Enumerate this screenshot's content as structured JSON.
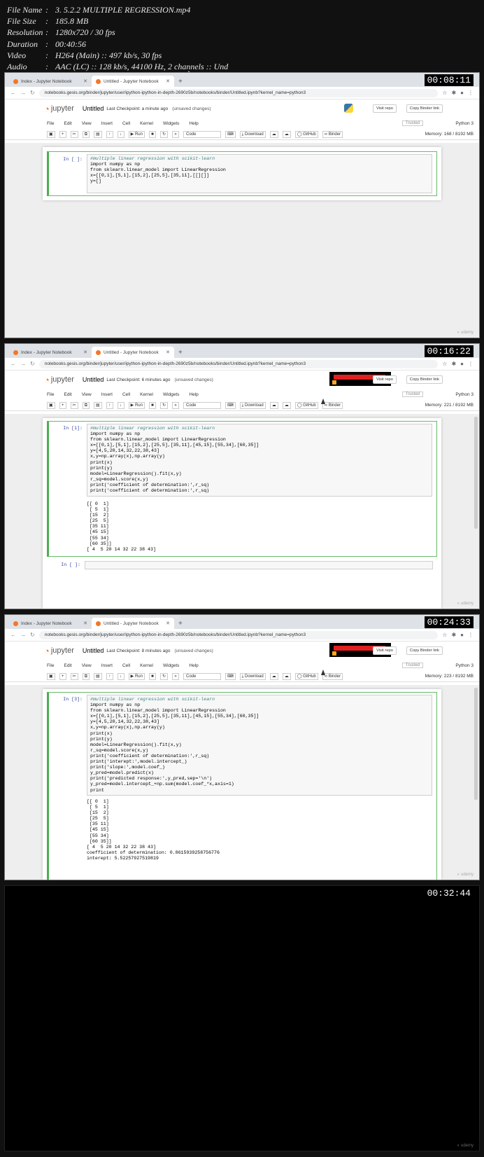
{
  "meta": [
    {
      "key": "File Name",
      "value": "3. 5.2.2 MULTIPLE REGRESSION.mp4"
    },
    {
      "key": "File Size",
      "value": "185.8 MB"
    },
    {
      "key": "Resolution",
      "value": "1280x720 / 30 fps"
    },
    {
      "key": "Duration",
      "value": "00:40:56"
    },
    {
      "key": "Video",
      "value": "H264 (Main) :: 497 kb/s, 30 fps"
    },
    {
      "key": "Audio",
      "value": "AAC (LC) :: 128 kb/s, 44100 Hz, 2 channels :: Und"
    }
  ],
  "browser": {
    "tab1": "Index - Jupyter Notebook",
    "tab2_f1": "Untitled - Jupyter Notebook",
    "tab2": "Untitled - Jupyter Notebook",
    "url": "notebooks.gesis.org/binder/jupyter/user/ipython-ipython-in-depth-2690z5b/notebooks/binder/Untitled.ipynb?kernel_name=python3"
  },
  "jupyter": {
    "logo_word": "jupyter",
    "title": "Untitled",
    "unsaved": "(unsaved changes)",
    "visit_repo": "Visit repo",
    "copy_binder": "Copy Binder link",
    "menus": [
      "File",
      "Edit",
      "View",
      "Insert",
      "Cell",
      "Kernel",
      "Widgets",
      "Help"
    ],
    "trusted": "Trusted",
    "kernel": "Python 3",
    "run": "Run",
    "celltype": "Code",
    "download": "Download",
    "github": "GitHub",
    "binder": "Binder"
  },
  "frames": [
    {
      "timestamp": "00:08:11",
      "checkpoint": "Last Checkpoint: a minute ago",
      "memory": "Memory: 168 / 8192 MB",
      "prompt": "In [ ]:",
      "code": [
        "#multiple linear regression with scikit-learn",
        "import numpy as np",
        "from sklearn.linear_model import LinearRegression",
        "x=[[0,1],[5,1],[15,2],[25,5],[35,11],[[][]]",
        "y=[]"
      ]
    },
    {
      "timestamp": "00:16:22",
      "checkpoint": "Last Checkpoint: 6 minutes ago",
      "memory": "Memory: 221 / 8192 MB",
      "prompt": "In [1]:",
      "code": [
        "#multiple linear regression with scikit-learn",
        "import numpy as np",
        "from sklearn.linear_model import LinearRegression",
        "x=[[0,1],[5,1],[15,2],[25,5],[35,11],[45,15],[55,34],[60,35]]",
        "y=[4,5,20,14,32,22,38,43]",
        "x,y=np.array(x),np.array(y)",
        "print(x)",
        "print(y)",
        "model=LinearRegression().fit(x,y)",
        "r_sq=model.score(x,y)",
        "print('coefficient of determination:',r_sq)",
        "print('coefficient of determination:',r_sq)"
      ],
      "output": [
        "[[ 0  1]",
        " [ 5  1]",
        " [15  2]",
        " [25  5]",
        " [35 11]",
        " [45 15]",
        " [55 34]",
        " [60 35]]",
        "[ 4  5 20 14 32 22 38 43]"
      ],
      "empty_prompt": "In [ ]:"
    },
    {
      "timestamp": "00:24:33",
      "checkpoint": "Last Checkpoint: 8 minutes ago",
      "memory": "Memory: 223 / 8192 MB",
      "prompt": "In [3]:",
      "code": [
        "#multiple linear regression with scikit-learn",
        "import numpy as np",
        "from sklearn.linear_model import LinearRegression",
        "x=[[0,1],[5,1],[15,2],[25,5],[35,11],[45,15],[55,34],[60,35]]",
        "y=[4,5,20,14,32,22,38,43]",
        "x,y=np.array(x),np.array(y)",
        "print(x)",
        "print(y)",
        "model=LinearRegression().fit(x,y)",
        "r_sq=model.score(x,y)",
        "print('coefficient of determination:',r_sq)",
        "print('interept:',model.intercept_)",
        "print('slope:',model.coef_)",
        "y_pred=model.predict(x)",
        "print('predicted response:',y_pred,sep='\\n')",
        "y_pred=model.intercept_+np.sum(model.coef_*x,axis=1)",
        "print"
      ],
      "output": [
        "[[ 0  1]",
        " [ 5  1]",
        " [15  2]",
        " [25  5]",
        " [35 11]",
        " [45 15]",
        " [55 34]",
        " [60 35]]",
        "[ 4  5 20 14 32 22 38 43]",
        "coefficient of determination: 0.8615939258756776",
        "interept: 5.52257927519819"
      ]
    },
    {
      "timestamp": "00:32:44"
    }
  ]
}
